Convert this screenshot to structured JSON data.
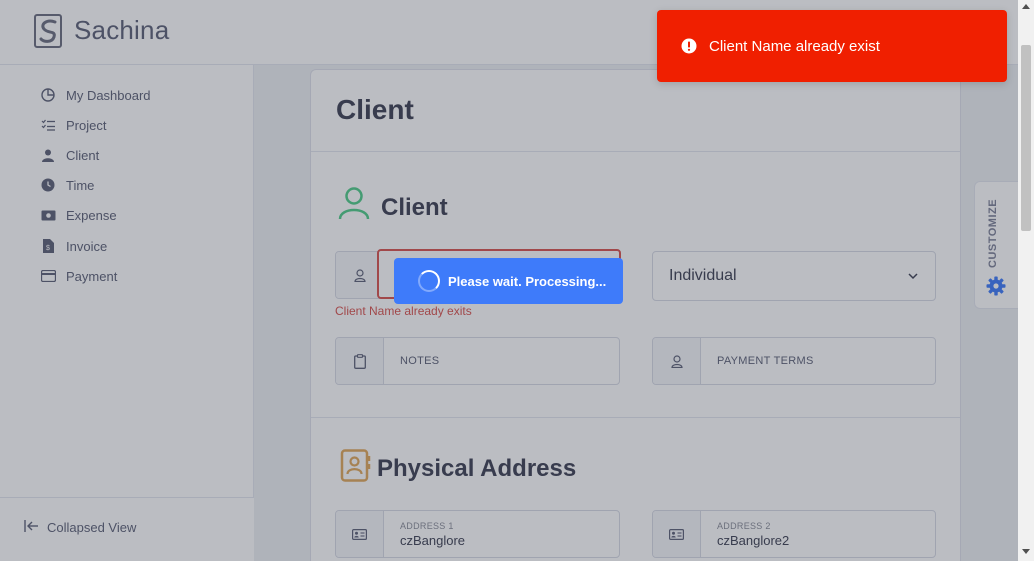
{
  "app": {
    "brand": "Sachina"
  },
  "sidebar": {
    "items": [
      {
        "label": "My Dashboard",
        "icon": "chart-pie-icon"
      },
      {
        "label": "Project",
        "icon": "list-check-icon"
      },
      {
        "label": "Client",
        "icon": "user-icon"
      },
      {
        "label": "Time",
        "icon": "clock-icon"
      },
      {
        "label": "Expense",
        "icon": "money-icon"
      },
      {
        "label": "Invoice",
        "icon": "file-invoice-icon"
      },
      {
        "label": "Payment",
        "icon": "credit-card-icon"
      }
    ],
    "collapse_label": "Collapsed View"
  },
  "page": {
    "title": "Client",
    "client_section_title": "Client",
    "client_name": {
      "value": "",
      "error": "Client Name already exits"
    },
    "client_type": {
      "value": "Individual"
    },
    "notes": {
      "label": "NOTES"
    },
    "payment_terms": {
      "label": "PAYMENT TERMS"
    },
    "address_section_title": "Physical Address",
    "address1": {
      "label": "ADDRESS 1",
      "value": "czBanglore"
    },
    "address2": {
      "label": "ADDRESS 2",
      "value": "czBanglore2"
    }
  },
  "customize": {
    "label": "CUSTOMIZE"
  },
  "toast": {
    "message": "Client Name already exist",
    "color": "#f01f00"
  },
  "loader": {
    "message": "Please wait. Processing..."
  },
  "colors": {
    "accent": "#3e7bfa",
    "error": "#d9534f",
    "client_icon": "#50cd89"
  }
}
